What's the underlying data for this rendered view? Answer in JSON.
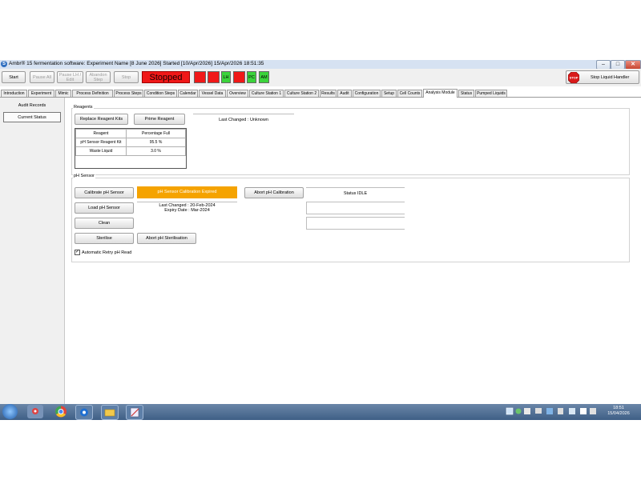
{
  "window": {
    "title": "Ambr® 15 fermentation software: Experiment Name [8 June 2026] Started [10/Apr/2026] 15/Apr/2026 18:51:35",
    "min": "–",
    "max": "□",
    "close": "✕"
  },
  "toolbar": {
    "start": "Start",
    "pause_all": "Pause All",
    "pause_lh": "Pause LH / Edit",
    "abandon_step": "Abandon Step",
    "stop": "Stop",
    "status": "Stopped",
    "indicators": [
      {
        "label": "",
        "color": "#f01818"
      },
      {
        "label": "",
        "color": "#f01818"
      },
      {
        "label": "LH",
        "color": "#3bd33b"
      },
      {
        "label": "",
        "color": "#f01818"
      },
      {
        "label": "PC",
        "color": "#3bd33b"
      },
      {
        "label": "AM",
        "color": "#3bd33b"
      }
    ],
    "stop_lh_icon": "STOP",
    "stop_liquid_handler": "Stop Liquid Handler"
  },
  "tabs": [
    "Introduction",
    "Experiment",
    "Mimic",
    "Process Definition",
    "Process Steps",
    "Condition Steps",
    "Calendar",
    "Vessel Data",
    "Overview",
    "Culture Station 1",
    "Culture Station 2",
    "Results",
    "Audit",
    "Configuration",
    "Setup",
    "Cell Counts",
    "Analysis Module",
    "Status",
    "Pumped Liquids"
  ],
  "active_tab": "Analysis Module",
  "sidebar": {
    "items": [
      "Audit Records",
      "Current Status"
    ],
    "selected": "Current Status"
  },
  "reagents": {
    "group_label": "Reagents",
    "replace_kits": "Replace Reagent Kits",
    "prime": "Prime Reagent",
    "last_changed": "Last Changed : Unknown",
    "table": {
      "headers": [
        "Reagent",
        "Percentage Full"
      ],
      "rows": [
        [
          "pH Sensor Reagent Kit",
          "95.5 %"
        ],
        [
          "Waste Liquid",
          "3.0 %"
        ]
      ]
    }
  },
  "ph_sensor": {
    "group_label": "pH Sensor",
    "calibrate": "Calibrate pH Sensor",
    "calibration_status": "pH Sensor Calibration Expired",
    "calibration_status_color": "#f5a300",
    "abort_calibration": "Abort pH Calibration",
    "status": "Status IDLE",
    "load": "Load pH Sensor",
    "last_changed": "Last Changed : 20-Feb-2024",
    "expiry": "Expiry Date : Mar-2024",
    "clean": "Clean",
    "sterilise": "Sterilise",
    "abort_sterilisation": "Abort pH Sterilisation",
    "auto_retry_label": "Automatic Retry pH Read",
    "auto_retry_checked": true
  },
  "taskbar": {
    "clock_time": "18:51",
    "clock_date": "15/04/2026"
  }
}
